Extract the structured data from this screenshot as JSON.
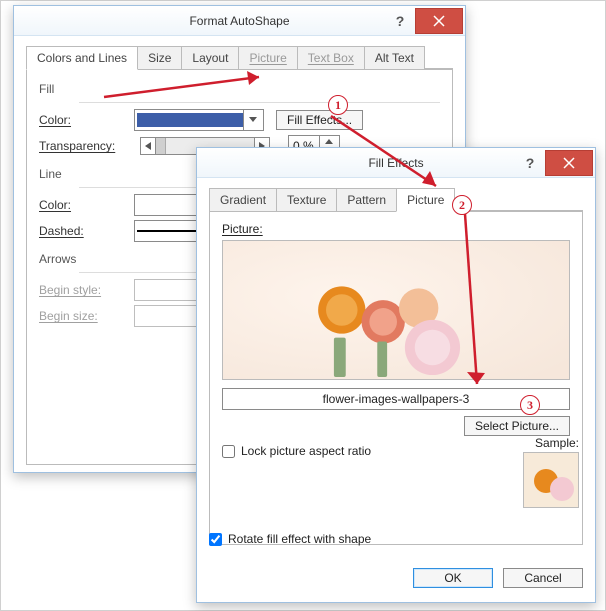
{
  "dialog1": {
    "title": "Format AutoShape",
    "tabs": [
      "Colors and Lines",
      "Size",
      "Layout",
      "Picture",
      "Text Box",
      "Alt Text"
    ],
    "active_tab": "Colors and Lines",
    "disabled_tabs": [
      "Picture",
      "Text Box"
    ],
    "fill": {
      "section": "Fill",
      "color_label": "Color:",
      "color_swatch": "#3d5ea8",
      "fill_effects_label": "Fill Effects...",
      "transparency_label": "Transparency:",
      "transparency_value": "0 %"
    },
    "line": {
      "section": "Line",
      "color_label": "Color:",
      "dashed_label": "Dashed:",
      "dashed_swatch": "#000000"
    },
    "arrows": {
      "section": "Arrows",
      "begin_style_label": "Begin style:",
      "begin_size_label": "Begin size:"
    }
  },
  "dialog2": {
    "title": "Fill Effects",
    "tabs": [
      "Gradient",
      "Texture",
      "Pattern",
      "Picture"
    ],
    "active_tab": "Picture",
    "picture_label": "Picture:",
    "filename": "flower-images-wallpapers-3",
    "select_picture_label": "Select Picture...",
    "lock_label": "Lock picture aspect ratio",
    "lock_checked": false,
    "rotate_label": "Rotate fill effect with shape",
    "rotate_checked": true,
    "sample_label": "Sample:",
    "ok_label": "OK",
    "cancel_label": "Cancel"
  },
  "callouts": {
    "c1": "1",
    "c2": "2",
    "c3": "3"
  }
}
